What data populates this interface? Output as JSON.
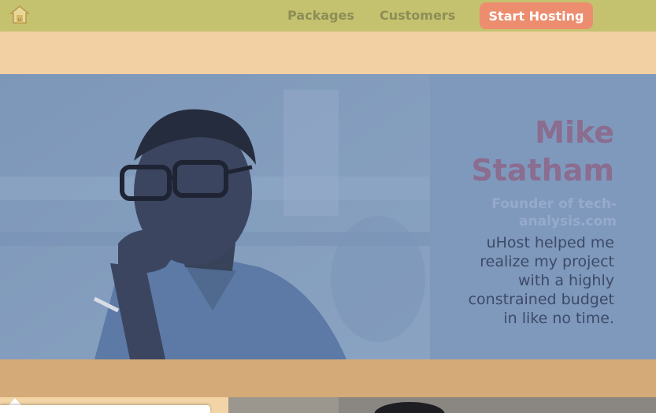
{
  "header": {
    "logo_icon": "uhost-logo-icon",
    "nav": [
      {
        "label": "Packages"
      },
      {
        "label": "Customers"
      }
    ],
    "cta_label": "Start Hosting"
  },
  "testimonial": {
    "photo_icon": "customer-portrait-photo",
    "name_line1": "Mike",
    "name_line2": "Statham",
    "role_line1": "Founder of tech-",
    "role_line2": "analysis.com",
    "quote": [
      "uHost helped me",
      "realize my project",
      "with a highly",
      "constrained budget",
      "in like no time."
    ]
  },
  "status_bar": {
    "text": ""
  },
  "colors": {
    "header_bg": "#c4c26f",
    "cta_bg": "#ed8d70",
    "testimonial_bg": "#7f99bd",
    "name_color": "#8a6d8f"
  }
}
